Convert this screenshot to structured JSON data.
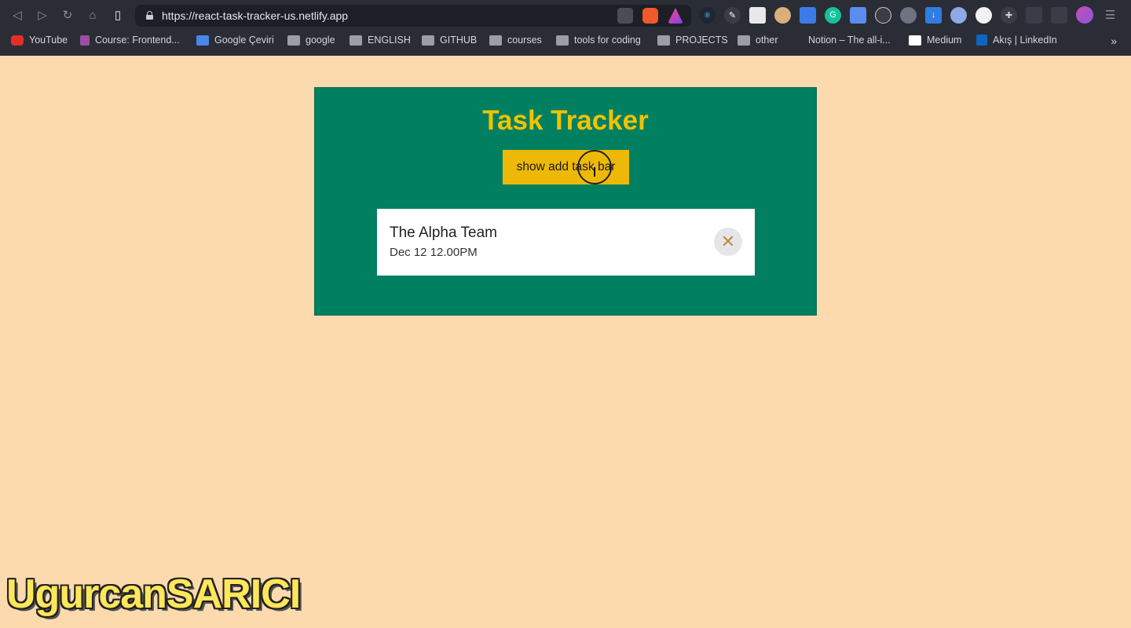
{
  "browser": {
    "url": "https://react-task-tracker-us.netlify.app",
    "bookmarks": [
      {
        "label": "YouTube",
        "icon": "youtube-icon"
      },
      {
        "label": "Course: Frontend...",
        "icon": "course-icon"
      },
      {
        "label": "Google Çeviri",
        "icon": "translate-icon"
      },
      {
        "label": "google",
        "icon": "folder-icon"
      },
      {
        "label": "ENGLISH",
        "icon": "folder-icon"
      },
      {
        "label": "GITHUB",
        "icon": "folder-icon"
      },
      {
        "label": "courses",
        "icon": "folder-icon"
      },
      {
        "label": "tools for coding",
        "icon": "folder-icon"
      },
      {
        "label": "PROJECTS",
        "icon": "folder-icon"
      },
      {
        "label": "other",
        "icon": "folder-icon"
      },
      {
        "label": "Notion – The all-i...",
        "icon": "notion-icon"
      },
      {
        "label": "Medium",
        "icon": "medium-icon"
      },
      {
        "label": "Akış | LinkedIn",
        "icon": "linkedin-icon"
      }
    ],
    "more_glyph": "»"
  },
  "app": {
    "title": "Task Tracker",
    "show_button_label": "show add task bar",
    "tasks": [
      {
        "text": "The Alpha Team",
        "day": "Dec 12 12.00PM"
      }
    ],
    "delete_glyph": "✕",
    "colors": {
      "background": "#fcdaae",
      "panel": "#008060",
      "accent": "#eeb906"
    }
  },
  "watermark": "UgurcanSARICI"
}
